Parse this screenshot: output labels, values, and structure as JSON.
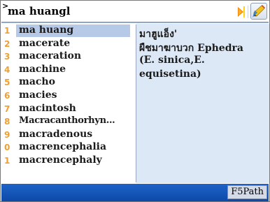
{
  "search": {
    "value": "ma huangl",
    "caret_glyph": ">"
  },
  "toolbar": {
    "next_icon": "play-arrow-icon",
    "edit_icon": "pencil-edit-icon"
  },
  "word_list": [
    {
      "index": "1",
      "word": "ma huang"
    },
    {
      "index": "2",
      "word": "macerate"
    },
    {
      "index": "3",
      "word": "maceration"
    },
    {
      "index": "4",
      "word": "machine"
    },
    {
      "index": "5",
      "word": "macho"
    },
    {
      "index": "6",
      "word": "macies"
    },
    {
      "index": "7",
      "word": "macintosh"
    },
    {
      "index": "8",
      "word": "Macracanthorhyn..."
    },
    {
      "index": "9",
      "word": "macradenous"
    },
    {
      "index": "0",
      "word": "macrencephalia"
    },
    {
      "index": "1",
      "word": "macrencephaly"
    }
  ],
  "selected_index": 0,
  "definition": {
    "line1": "มาฮูแอ็ง'",
    "line2": "ผืชมาฆาบวก Ephedra",
    "line3": "(E. sinica,E.",
    "line4": "equisetina)"
  },
  "status": {
    "f5_label": "F5Path"
  },
  "colors": {
    "accent_number": "#f0a030",
    "selection": "#b6cae8",
    "definition_bg": "#dde8f6",
    "statusbar": "#1e63c8"
  }
}
